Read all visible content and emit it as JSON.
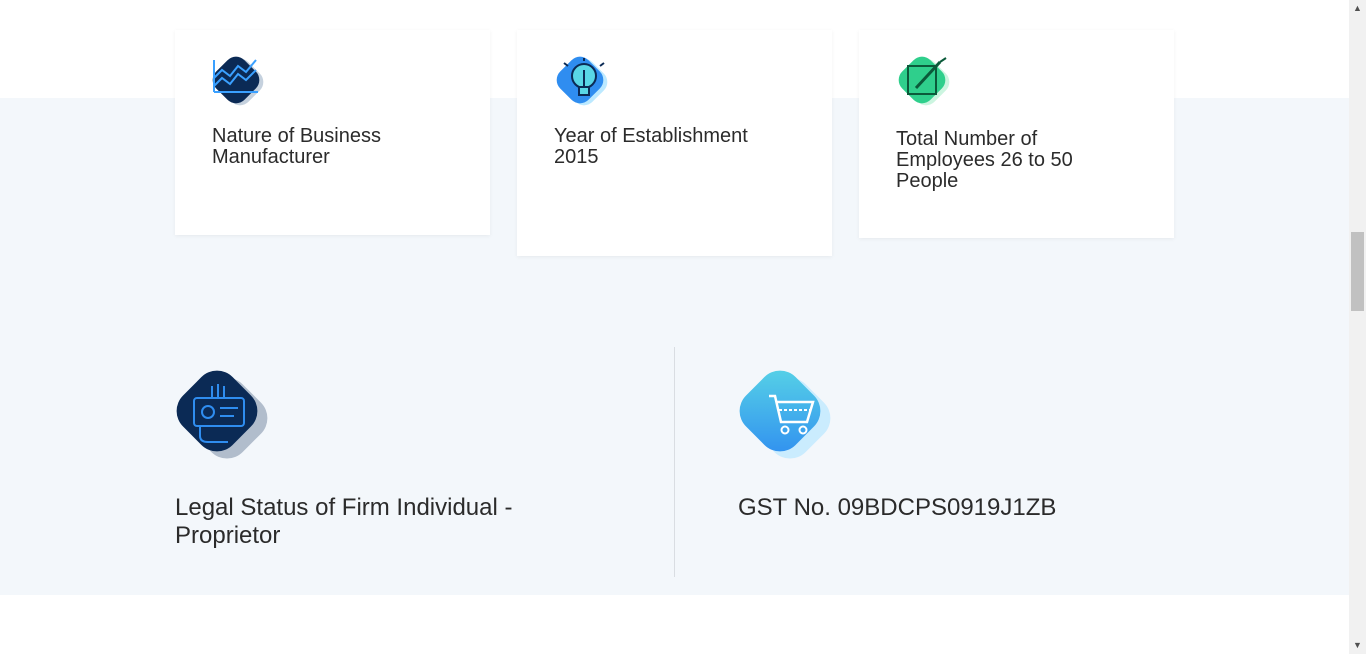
{
  "cards": [
    {
      "label": "Nature of Business Manufacturer",
      "icon": "chart-icon"
    },
    {
      "label": "Year of Establishment 2015",
      "icon": "lightbulb-icon"
    },
    {
      "label": "Total Number of Employees 26 to 50 People",
      "icon": "edit-note-icon"
    }
  ],
  "details": [
    {
      "label": "Legal Status of Firm Individual - Proprietor",
      "icon": "id-card-hand-icon"
    },
    {
      "label": "GST No. 09BDCPS0919J1ZB",
      "icon": "shopping-cart-icon"
    }
  ],
  "colors": {
    "band_bg": "#f3f7fb",
    "navy": "#0b2a55",
    "blue": "#2f8df0",
    "cyan": "#59d6e6",
    "green": "#2fcf8c"
  }
}
